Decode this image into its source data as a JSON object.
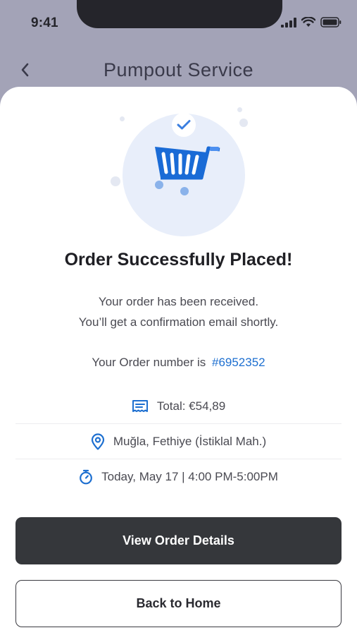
{
  "status_bar": {
    "time": "9:41"
  },
  "header": {
    "title": "Pumpout Service"
  },
  "confirmation": {
    "title": "Order Successfully Placed!",
    "message_line1": "Your order has been received.",
    "message_line2": "You’ll get a confirmation email shortly.",
    "order_label": "Your Order number is",
    "order_number": "#6952352"
  },
  "details": {
    "total": "Total: €54,89",
    "location": "Muğla, Fethiye (İstiklal Mah.)",
    "schedule": "Today, May 17 | 4:00 PM-5:00PM"
  },
  "actions": {
    "primary_label": "View Order Details",
    "secondary_label": "Back to Home"
  },
  "colors": {
    "accent": "#1d6fd0",
    "backdrop": "#a3a3b7",
    "primary_button": "#35373b"
  },
  "icons": [
    "back-arrow-icon",
    "signal-icon",
    "wifi-icon",
    "battery-icon",
    "shopping-cart-icon",
    "checkmark-icon",
    "receipt-icon",
    "location-pin-icon",
    "timer-icon"
  ]
}
